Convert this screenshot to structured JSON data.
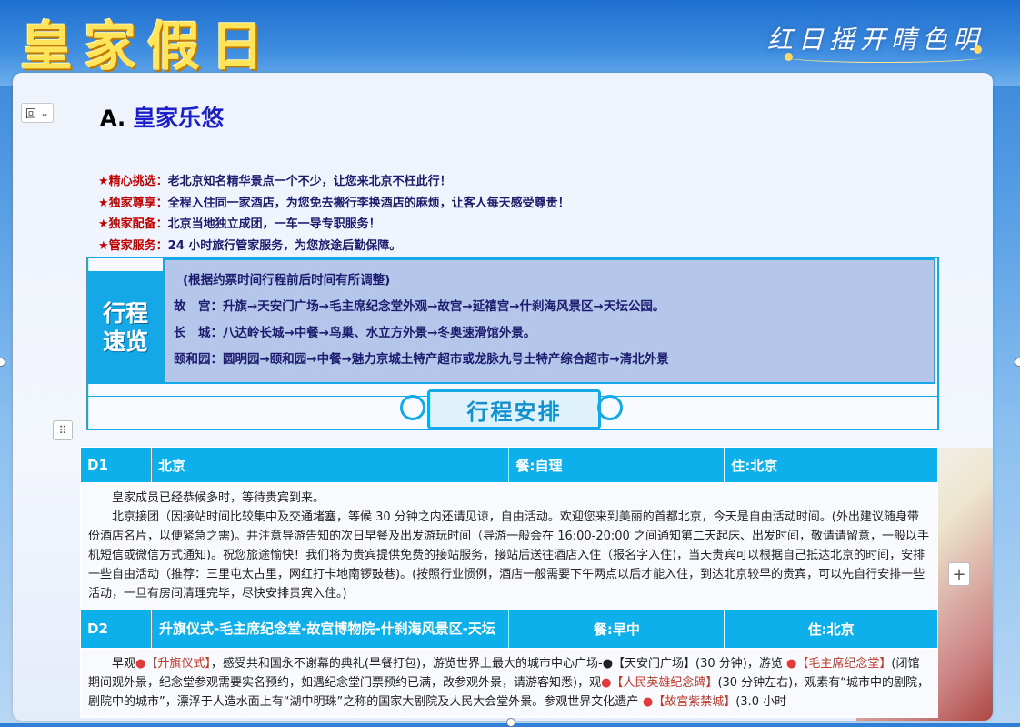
{
  "banner": {
    "logo": "皇家假日",
    "slogan": "红日摇开晴色明"
  },
  "controls": {
    "table_toggle": "回",
    "drag_handle": "⠿",
    "add": "+"
  },
  "title": {
    "letter": "A.",
    "name": "皇家乐悠"
  },
  "features": [
    {
      "key": "★精心挑选：",
      "text": "老北京知名精华景点一个不少，让您来北京不枉此行！"
    },
    {
      "key": "★独家尊享：",
      "text": "全程入住同一家酒店，为您免去搬行李换酒店的麻烦，让客人每天感受尊贵！"
    },
    {
      "key": "★独家配备：",
      "text": "北京当地独立成团，一车一导专职服务！"
    },
    {
      "key": "★管家服务：",
      "text": "24 小时旅行管家服务，为您旅途后勤保障。"
    }
  ],
  "overview": {
    "label_line1": "行程",
    "label_line2": "速览",
    "note": "(根据约票时间行程前后时间有所调整)",
    "lines": [
      "故　宫：升旗→天安门广场→毛主席纪念堂外观→故宫→延禧宫→什刹海风景区→天坛公园。",
      "长　城：八达岭长城→中餐→鸟巢、水立方外景→冬奥速滑馆外景。",
      "颐和园：圆明园→颐和园→中餐→魅力京城土特产超市或龙脉九号土特产综合超市→清北外景"
    ],
    "section_title": "行程安排"
  },
  "schedule": {
    "d1": {
      "day": "D1",
      "route": "北京",
      "meal": "餐:自理",
      "stay": "住:北京",
      "p1": "皇家成员已经恭候多时，等待贵宾到来。",
      "p2": "北京接团（因接站时间比较集中及交通堵塞，等候 30 分钟之内还请见谅，自由活动。欢迎您来到美丽的首都北京，今天是自由活动时间。(外出建议随身带份酒店名片，以便紧急之需)。并注意导游告知的次日早餐及出发游玩时间（导游一般会在 16:00-20:00 之间通知第二天起床、出发时间，敬请请留意，一般以手机短信或微信方式通知)。祝您旅途愉快！我们将为贵宾提供免费的接站服务，接站后送往酒店入住（报名字入住)，当天贵宾可以根据自己抵达北京的时间，安排一些自由活动（推荐：三里屯太古里，网红打卡地南锣鼓巷)。(按照行业惯例，酒店一般需要下午两点以后才能入住，到达北京较早的贵宾，可以先自行安排一些活动，一旦有房间清理完毕，尽快安排贵宾入住。)"
    },
    "d2": {
      "day": "D2",
      "route": "升旗仪式-毛主席纪念堂-故宫博物院-什刹海风景区-天坛",
      "meal": "餐:早中",
      "stay": "住:北京",
      "t1": "早观",
      "hl1": "【升旗仪式】",
      "t2": "，感受共和国永不谢幕的典礼(早餐打包)，游览世界上最大的城市中心广场-●【天安门广场】(30 分钟)，游览 ",
      "hl2": "【毛主席纪念堂】",
      "t3": "(闭馆期间观外景，纪念堂参观需要实名预约，如遇纪念堂门票预约已满，改参观外景，请游客知悉)，观",
      "hl3": "【人民英雄纪念碑】",
      "t4": "(30 分钟左右)，观素有“城市中的剧院，剧院中的城市”，漂浮于人造水面上有“湖中明珠”之称的国家大剧院及人民大会堂外景。参观世界文化遗产-",
      "hl4": "【故宫紫禁城】",
      "t5": "(3.0 小时"
    }
  },
  "colors": {
    "accent": "#13a8e8",
    "header_bg": "#0db0ea",
    "feature_key": "#c00000",
    "title_name": "#1c20c9",
    "highlight": "#c0392b"
  }
}
